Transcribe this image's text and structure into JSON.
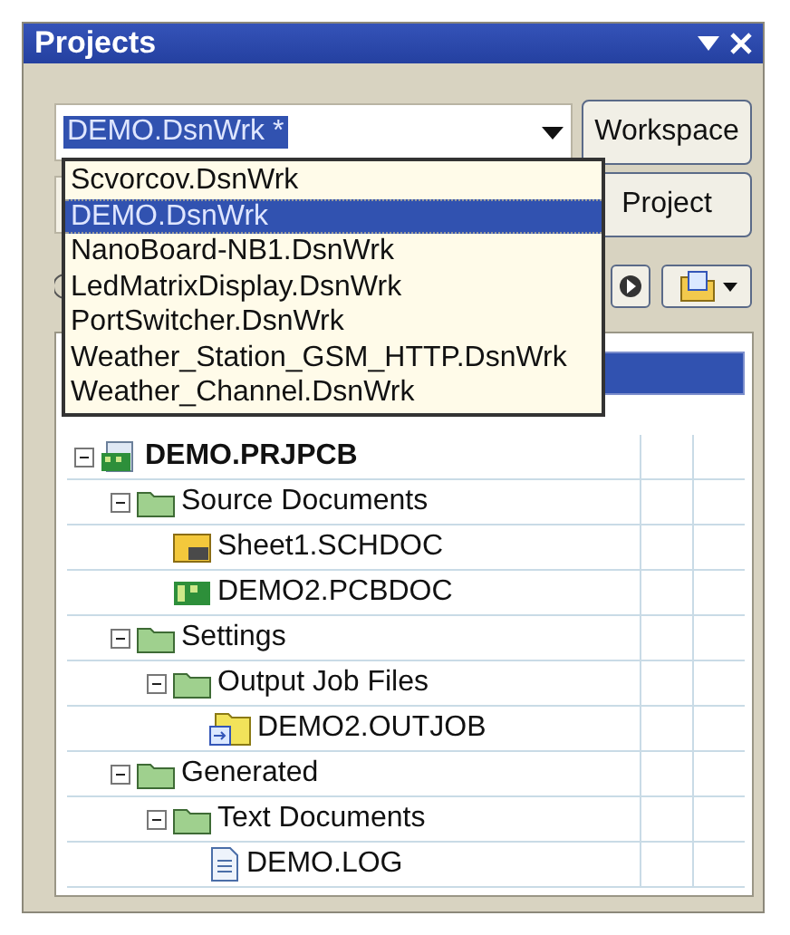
{
  "panel": {
    "title": "Projects"
  },
  "workspace_combo": {
    "value": "DEMO.DsnWrk *"
  },
  "buttons": [
    {
      "label": "Workspace"
    },
    {
      "label": "Project"
    }
  ],
  "dropdown": [
    {
      "label": "Scvorcov.DsnWrk",
      "selected": false
    },
    {
      "label": "DEMO.DsnWrk",
      "selected": true
    },
    {
      "label": "NanoBoard-NB1.DsnWrk",
      "selected": false
    },
    {
      "label": "LedMatrixDisplay.DsnWrk",
      "selected": false
    },
    {
      "label": "PortSwitcher.DsnWrk",
      "selected": false
    },
    {
      "label": "Weather_Station_GSM_HTTP.DsnWrk",
      "selected": false
    },
    {
      "label": "Weather_Channel.DsnWrk",
      "selected": false
    }
  ],
  "tree": [
    {
      "label": "DEMO.PRJPCB",
      "kind": "project",
      "expanded": true,
      "children": [
        {
          "label": "Source Documents",
          "kind": "folder",
          "expanded": true,
          "children": [
            {
              "label": "Sheet1.SCHDOC",
              "kind": "schematic"
            },
            {
              "label": "DEMO2.PCBDOC",
              "kind": "pcb"
            }
          ]
        },
        {
          "label": "Settings",
          "kind": "folder",
          "expanded": true,
          "children": [
            {
              "label": "Output Job Files",
              "kind": "folder",
              "expanded": true,
              "children": [
                {
                  "label": "DEMO2.OUTJOB",
                  "kind": "outjob"
                }
              ]
            }
          ]
        },
        {
          "label": "Generated",
          "kind": "folder",
          "expanded": true,
          "children": [
            {
              "label": "Text Documents",
              "kind": "folder",
              "expanded": true,
              "children": [
                {
                  "label": "DEMO.LOG",
                  "kind": "log"
                }
              ]
            }
          ]
        }
      ]
    }
  ]
}
